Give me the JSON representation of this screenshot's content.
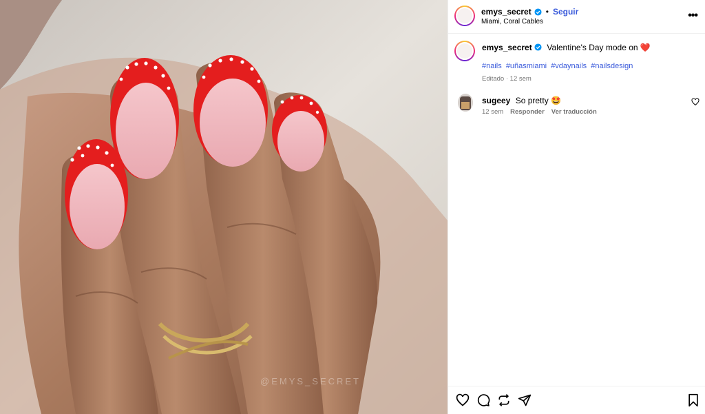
{
  "post": {
    "username": "emys_secret",
    "separator": "•",
    "follow_label": "Seguir",
    "location": "Miami, Coral Cables",
    "more_label": "•••",
    "watermark": "@EMYS_SECRET"
  },
  "caption": {
    "username": "emys_secret",
    "text": "Valentine's Day mode on",
    "emoji": "❤️",
    "hashtags": [
      "#nails",
      "#uñasmiami",
      "#vdaynails",
      "#nailsdesign"
    ],
    "meta": "Editado · 12 sem"
  },
  "comments": [
    {
      "username": "sugeey",
      "text": "So pretty",
      "emoji": "🤩",
      "time": "12 sem",
      "reply_label": "Responder",
      "translate_label": "Ver traducción"
    }
  ],
  "actions": {
    "icons": [
      "heart-icon",
      "comment-icon",
      "repost-icon",
      "share-icon",
      "bookmark-icon"
    ]
  },
  "colors": {
    "link": "#3b5bdb",
    "verified": "#0095f6",
    "nail_red": "#e41e1e",
    "nail_pink": "#f0b6bd",
    "skin": "#b07b5d"
  }
}
